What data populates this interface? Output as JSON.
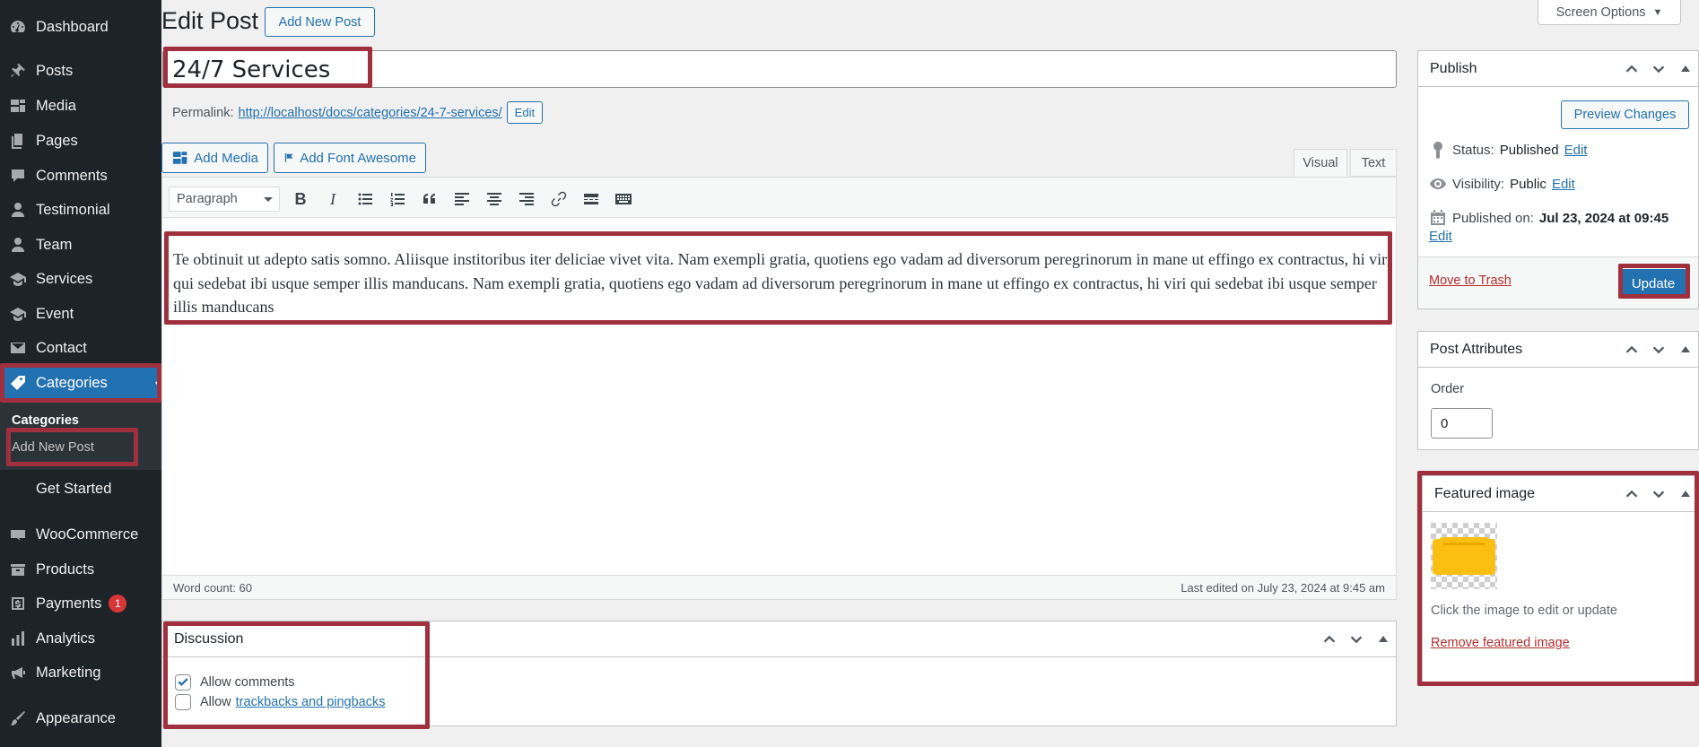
{
  "sidebar": {
    "items": [
      {
        "label": "Dashboard",
        "icon": "dashboard-icon"
      },
      {
        "label": "Posts",
        "icon": "pin-icon"
      },
      {
        "label": "Media",
        "icon": "media-icon"
      },
      {
        "label": "Pages",
        "icon": "pages-icon"
      },
      {
        "label": "Comments",
        "icon": "comment-icon"
      },
      {
        "label": "Testimonial",
        "icon": "person-icon"
      },
      {
        "label": "Team",
        "icon": "person-icon"
      },
      {
        "label": "Services",
        "icon": "graduation-cap-icon"
      },
      {
        "label": "Event",
        "icon": "graduation-cap-icon"
      },
      {
        "label": "Contact",
        "icon": "envelope-icon"
      },
      {
        "label": "Categories",
        "icon": "tag-icon"
      },
      {
        "label": "Get Started",
        "icon": ""
      },
      {
        "label": "WooCommerce",
        "icon": "woo-icon"
      },
      {
        "label": "Products",
        "icon": "archive-icon"
      },
      {
        "label": "Payments",
        "icon": "dollar-icon",
        "badge": "1"
      },
      {
        "label": "Analytics",
        "icon": "bar-chart-icon"
      },
      {
        "label": "Marketing",
        "icon": "megaphone-icon"
      },
      {
        "label": "Appearance",
        "icon": "brush-icon"
      }
    ],
    "submenu": {
      "heading": "Categories",
      "add_new": "Add New Post"
    }
  },
  "header": {
    "title": "Edit Post",
    "add_new_label": "Add New Post",
    "screen_options_label": "Screen Options"
  },
  "post": {
    "title": "24/7 Services",
    "permalink_label": "Permalink:",
    "permalink_url": "http://localhost/docs/categories/24-7-services/",
    "permalink_edit": "Edit"
  },
  "editor": {
    "add_media_label": "Add Media",
    "add_font_awesome_label": "Add Font Awesome",
    "tabs": {
      "visual": "Visual",
      "text": "Text"
    },
    "format_value": "Paragraph",
    "content": "Te obtinuit ut adepto satis somno. Aliisque institoribus iter deliciae vivet vita. Nam exempli gratia, quotiens ego vadam ad diversorum peregrinorum in mane ut effingo ex contractus, hi viri qui sedebat ibi usque semper illis manducans. Nam exempli gratia, quotiens ego vadam ad diversorum peregrinorum in mane ut effingo ex contractus, hi viri qui sedebat ibi usque semper illis manducans",
    "word_count": "Word count: 60",
    "last_edited": "Last edited on July 23, 2024 at 9:45 am"
  },
  "discussion": {
    "title": "Discussion",
    "allow_comments": "Allow comments",
    "allow_comments_checked": true,
    "allow_prefix": "Allow",
    "trackbacks_link": "trackbacks and pingbacks",
    "trackbacks_checked": false
  },
  "publish": {
    "title": "Publish",
    "preview_label": "Preview Changes",
    "status_label": "Status:",
    "status_value": "Published",
    "visibility_label": "Visibility:",
    "visibility_value": "Public",
    "published_label": "Published on:",
    "published_value": "Jul 23, 2024 at 09:45",
    "edit_label": "Edit",
    "trash_label": "Move to Trash",
    "update_label": "Update"
  },
  "attributes": {
    "title": "Post Attributes",
    "order_label": "Order",
    "order_value": "0"
  },
  "featured": {
    "title": "Featured image",
    "hint": "Click the image to edit or update",
    "remove_label": "Remove featured image"
  },
  "colors": {
    "sidebar_bg": "#1d2327",
    "accent": "#2271b1",
    "highlight": "#a0303d",
    "trash": "#b32d2e",
    "thumbnail_yellow": "#fbbf12"
  }
}
